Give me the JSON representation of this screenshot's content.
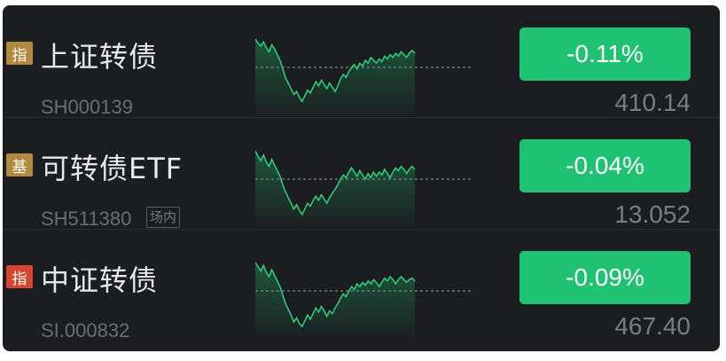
{
  "colors": {
    "background": "#1c1d20",
    "up_down_badge": "#1ec272",
    "index_tag": "#b18a3e",
    "fund_tag": "#b18a3e",
    "index_tag_red": "#d5452f",
    "line": "#2ddd80"
  },
  "rows": [
    {
      "tag": "指",
      "tag_color": "#b18a3e",
      "name": "上证转债",
      "code": "SH000139",
      "badge": "",
      "change": "-0.11%",
      "price": "410.14",
      "spark": [
        0.0,
        0.06,
        0.1,
        0.04,
        0.12,
        0.18,
        0.08,
        0.14,
        0.22,
        0.3,
        0.42,
        0.55,
        0.62,
        0.7,
        0.78,
        0.74,
        0.82,
        0.88,
        0.8,
        0.72,
        0.76,
        0.68,
        0.6,
        0.66,
        0.58,
        0.64,
        0.7,
        0.62,
        0.68,
        0.74,
        0.66,
        0.56,
        0.5,
        0.54,
        0.46,
        0.4,
        0.36,
        0.42,
        0.34,
        0.38,
        0.3,
        0.34,
        0.26,
        0.3,
        0.34,
        0.28,
        0.32,
        0.24,
        0.28,
        0.22,
        0.26,
        0.2,
        0.24,
        0.18,
        0.22,
        0.26,
        0.2,
        0.16,
        0.2
      ]
    },
    {
      "tag": "基",
      "tag_color": "#b18a3e",
      "name": "可转债ETF",
      "code": "SH511380",
      "badge": "场内",
      "change": "-0.04%",
      "price": "13.052",
      "spark": [
        0.0,
        0.08,
        0.14,
        0.06,
        0.16,
        0.22,
        0.12,
        0.2,
        0.28,
        0.36,
        0.48,
        0.58,
        0.66,
        0.74,
        0.82,
        0.76,
        0.84,
        0.9,
        0.82,
        0.74,
        0.78,
        0.7,
        0.64,
        0.7,
        0.62,
        0.68,
        0.74,
        0.66,
        0.6,
        0.54,
        0.48,
        0.4,
        0.34,
        0.38,
        0.3,
        0.24,
        0.3,
        0.36,
        0.28,
        0.34,
        0.4,
        0.32,
        0.38,
        0.3,
        0.36,
        0.3,
        0.34,
        0.26,
        0.32,
        0.38,
        0.3,
        0.24,
        0.28,
        0.22,
        0.26,
        0.32,
        0.26,
        0.22,
        0.26
      ]
    },
    {
      "tag": "指",
      "tag_color": "#d5452f",
      "name": "中证转债",
      "code": "SI.000832",
      "badge": "",
      "change": "-0.09%",
      "price": "467.40",
      "spark": [
        0.0,
        0.06,
        0.12,
        0.04,
        0.14,
        0.2,
        0.1,
        0.18,
        0.26,
        0.34,
        0.46,
        0.58,
        0.66,
        0.74,
        0.84,
        0.78,
        0.86,
        0.9,
        0.82,
        0.74,
        0.8,
        0.72,
        0.64,
        0.7,
        0.62,
        0.68,
        0.76,
        0.68,
        0.72,
        0.64,
        0.58,
        0.5,
        0.44,
        0.48,
        0.4,
        0.34,
        0.38,
        0.3,
        0.34,
        0.28,
        0.32,
        0.26,
        0.3,
        0.24,
        0.28,
        0.34,
        0.28,
        0.22,
        0.26,
        0.2,
        0.24,
        0.3,
        0.24,
        0.2,
        0.24,
        0.28,
        0.24,
        0.22,
        0.26
      ]
    }
  ]
}
